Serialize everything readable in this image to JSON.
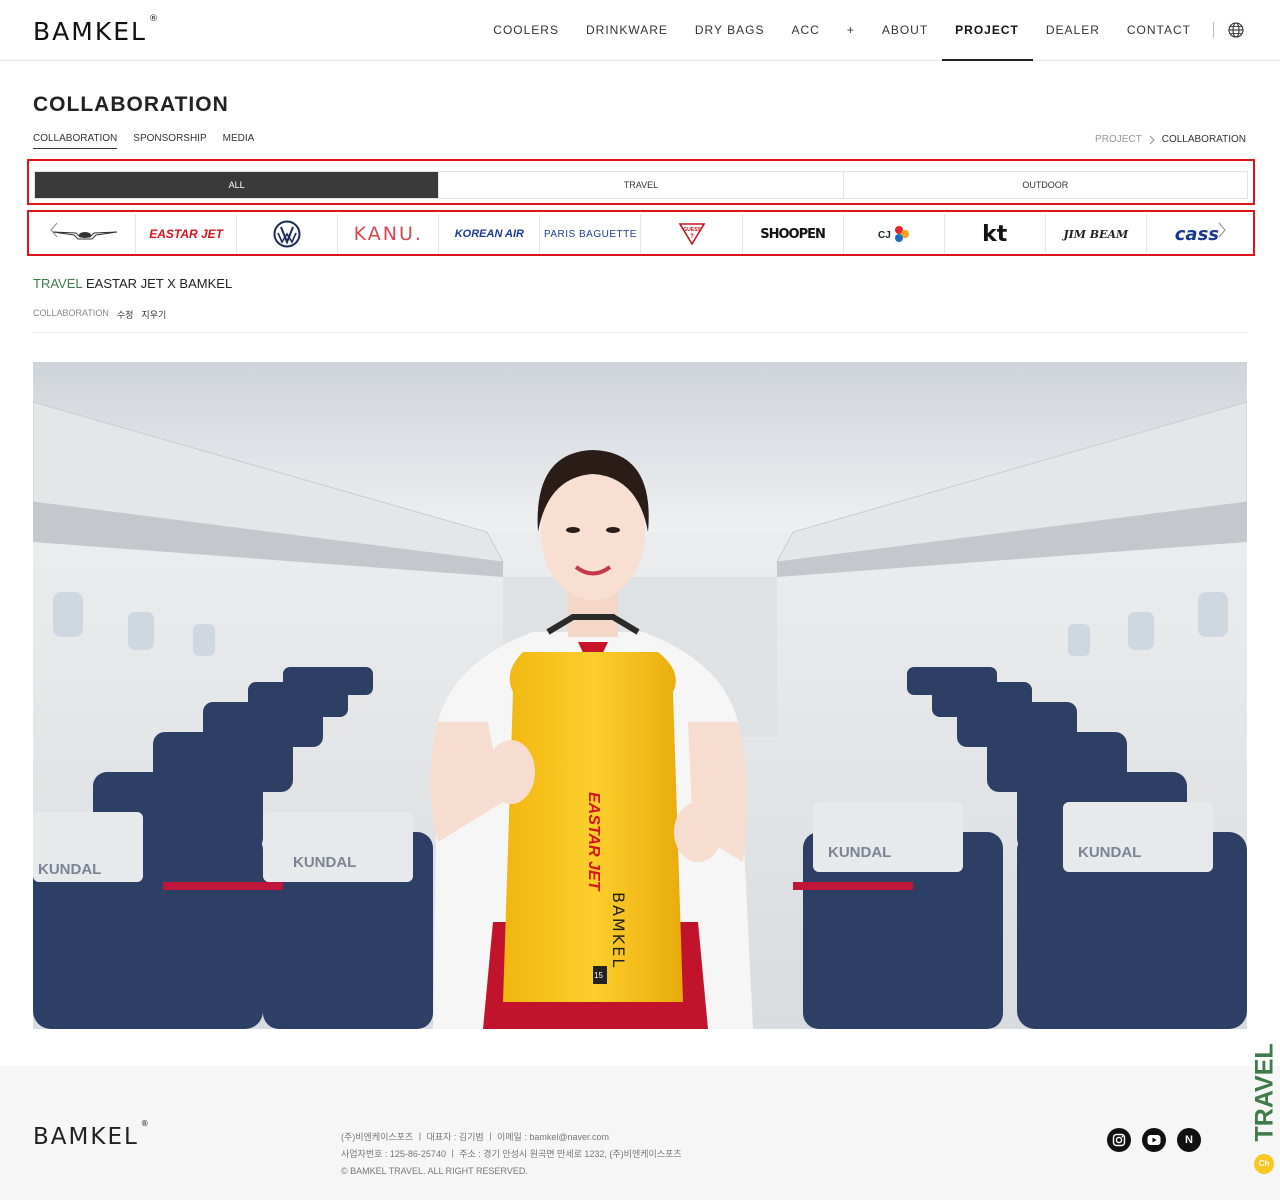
{
  "header": {
    "logo": "BAMKEL",
    "logo_mark": "®",
    "nav": [
      "COOLERS",
      "DRINKWARE",
      "DRY BAGS",
      "ACC",
      "+",
      "ABOUT",
      "PROJECT",
      "DEALER",
      "CONTACT"
    ],
    "active_nav": "PROJECT"
  },
  "page": {
    "title": "COLLABORATION",
    "subtabs": [
      "COLLABORATION",
      "SPONSORSHIP",
      "MEDIA"
    ],
    "breadcrumb": {
      "parent": "PROJECT",
      "current": "COLLABORATION"
    }
  },
  "filters": [
    "ALL",
    "TRAVEL",
    "OUTDOOR"
  ],
  "brands": [
    "GENESIS",
    "EASTAR JET",
    "VW",
    "KANU.",
    "KOREAN AIR",
    "PARIS BAGUETTE",
    "GUESS",
    "SHOOPEN",
    "CJ",
    "kt",
    "JIM BEAM",
    "cass"
  ],
  "post": {
    "category": "TRAVEL",
    "title": "EASTAR JET X BAMKEL",
    "meta": {
      "category": "COLLABORATION",
      "edit": "수정",
      "delete": "지우기"
    }
  },
  "hero": {
    "bag_brand": "EASTAR JET",
    "bag_text": "BAMKEL",
    "bag_size": "15",
    "seat_text": "KUNDAL"
  },
  "footer": {
    "logo": "BAMKEL",
    "logo_mark": "®",
    "line1": "(주)비엔케이스포츠  ㅣ  대표자 : 김기범  ㅣ  이메일 : bamkel@naver.com",
    "line2": "사업자번호 : 125-86-25740  ㅣ  주소 : 경기 안성시 원곡면 만세로 1232, (주)비엔케이스포츠",
    "line3": "© BAMKEL TRAVEL. ALL RIGHT RESERVED.",
    "social": [
      "instagram",
      "youtube",
      "naver"
    ],
    "naver_letter": "N",
    "side_label": "TRAVEL",
    "chat_label": "Ch"
  }
}
